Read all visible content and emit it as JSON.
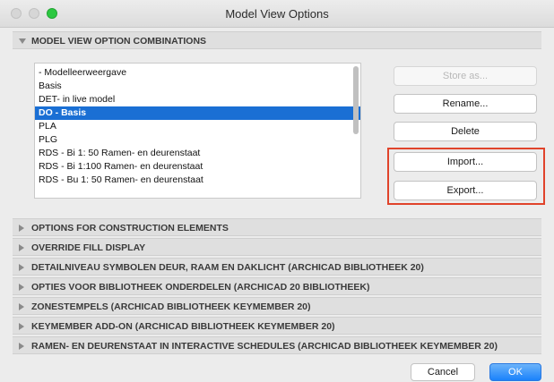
{
  "window": {
    "title": "Model View Options"
  },
  "combinations": {
    "header": "MODEL VIEW OPTION COMBINATIONS",
    "items": [
      "- Modelleerweergave",
      "Basis",
      "DET- in live model",
      "DO - Basis",
      "PLA",
      "PLG",
      "RDS - Bi 1: 50 Ramen- en deurenstaat",
      "RDS - Bi 1:100 Ramen- en deurenstaat",
      "RDS - Bu 1: 50 Ramen- en deurenstaat"
    ],
    "selected_item": "DO - Basis"
  },
  "buttons": {
    "store_as": "Store as...",
    "rename": "Rename...",
    "delete": "Delete",
    "import": "Import...",
    "export": "Export..."
  },
  "sections": [
    "OPTIONS FOR CONSTRUCTION ELEMENTS",
    "OVERRIDE FILL DISPLAY",
    "DETAILNIVEAU SYMBOLEN DEUR, RAAM EN DAKLICHT (ARCHICAD BIBLIOTHEEK 20)",
    "OPTIES VOOR BIBLIOTHEEK ONDERDELEN (ARCHICAD 20 BIBLIOTHEEK)",
    "ZONESTEMPELS (ARCHICAD BIBLIOTHEEK KEYMEMBER 20)",
    "KEYMEMBER ADD-ON (ARCHICAD BIBLIOTHEEK KEYMEMBER 20)",
    "RAMEN- EN DEURENSTAAT IN INTERACTIVE SCHEDULES (ARCHICAD BIBLIOTHEEK KEYMEMBER 20)"
  ],
  "footer": {
    "cancel": "Cancel",
    "ok": "OK"
  },
  "colors": {
    "selection": "#1a6fd4",
    "highlight_box": "#e0432b",
    "ok_button": "#1a82fb"
  }
}
